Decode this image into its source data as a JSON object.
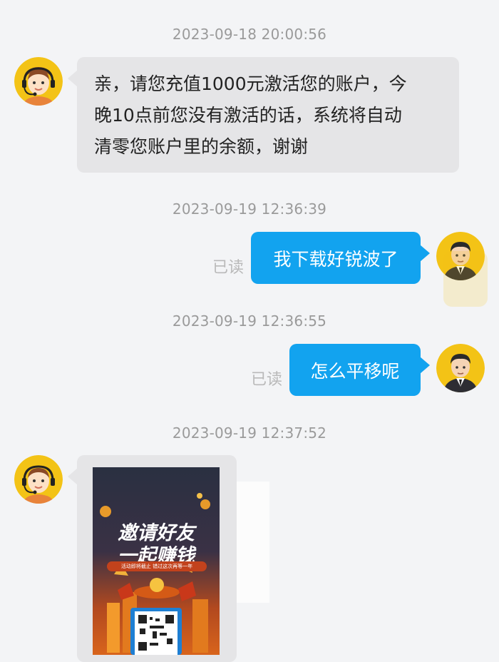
{
  "messages": [
    {
      "time": "2023-09-18 20:00:56",
      "text_lines": [
        "亲，请您充值1000元激活您的账户，今",
        "晚10点前您没有激活的话，系统将自动",
        "清零您账户里的余额，谢谢"
      ]
    },
    {
      "time": "2023-09-19 12:36:39",
      "text": "我下载好锐波了",
      "read": "已读"
    },
    {
      "time": "2023-09-19 12:36:55",
      "text": "怎么平移呢",
      "read": "已读"
    },
    {
      "time": "2023-09-19 12:37:52"
    }
  ],
  "poster": {
    "line1": "邀请好友",
    "line2": "一起赚钱",
    "ribbon": "活动即将截止  错过这次再等一年"
  },
  "colors": {
    "outgoing_bubble": "#12a3ef",
    "incoming_bubble": "#e5e5e7",
    "avatar_bg": "#f3c316"
  },
  "icons": {
    "agent_avatar": "customer-service-agent-icon",
    "user_avatar": "man-in-suit-icon"
  }
}
